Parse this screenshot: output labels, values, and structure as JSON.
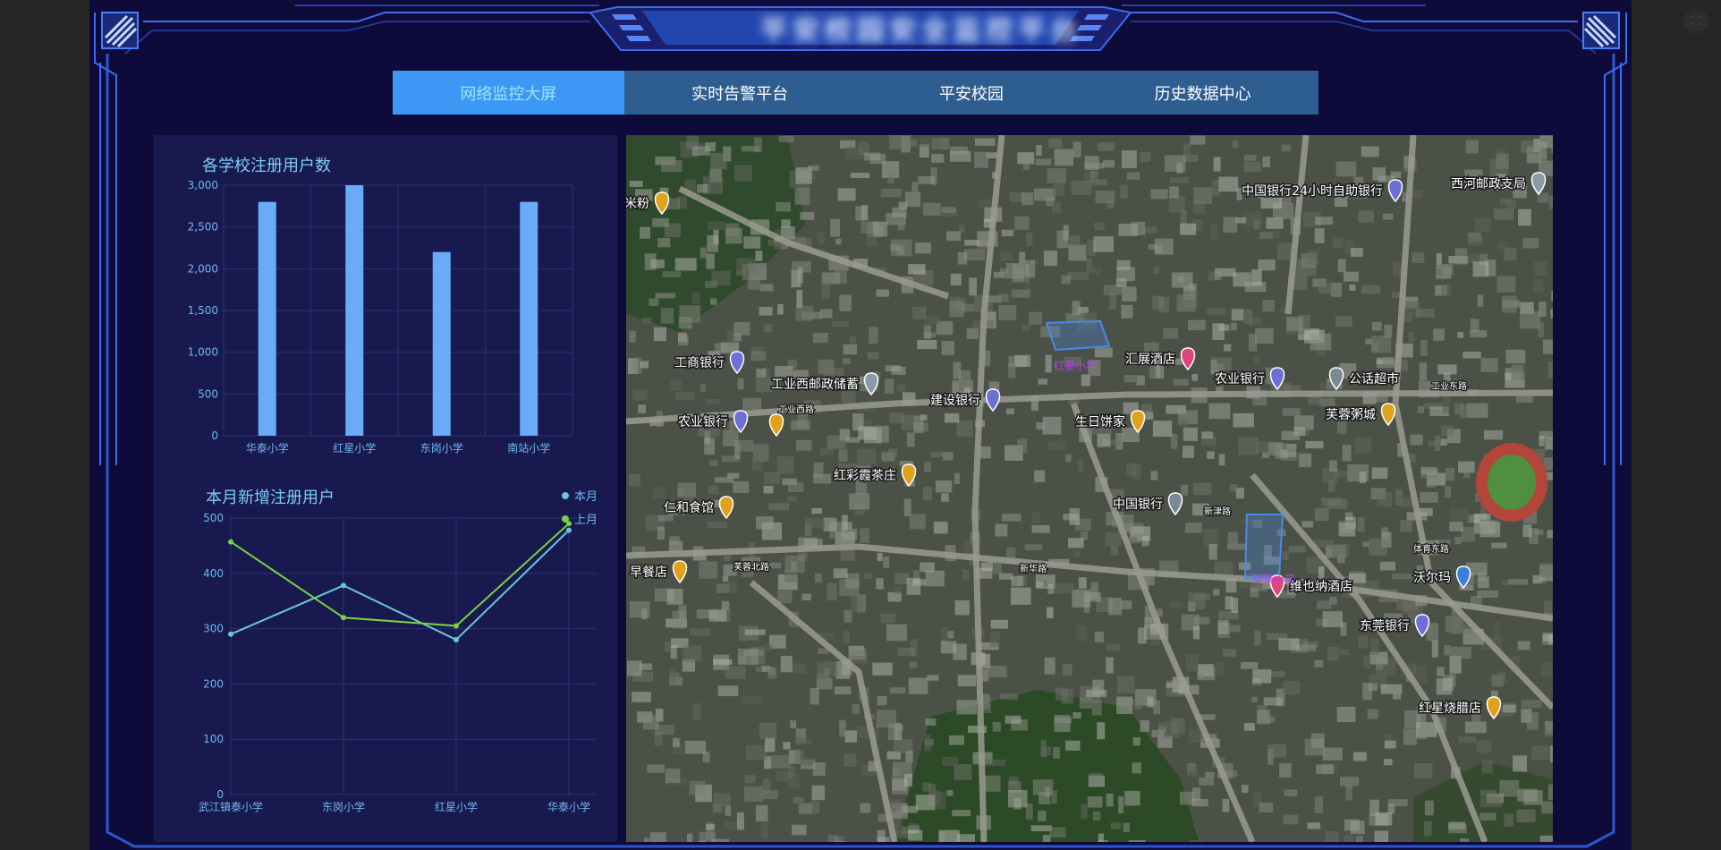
{
  "header": {
    "title": "平安校园安全监控平台"
  },
  "nav": {
    "tabs": [
      {
        "label": "网络监控大屏",
        "active": true
      },
      {
        "label": "实时告警平台",
        "active": false
      },
      {
        "label": "平安校园",
        "active": false
      },
      {
        "label": "历史数据中心",
        "active": false
      }
    ]
  },
  "colors": {
    "background": "#0e0b3a",
    "panel": "#181a4f",
    "accent": "#3d97f5",
    "bar": "#6aaaf8",
    "series_this_month": "#6fc4d8",
    "series_last_month": "#7ad142"
  },
  "chart_data": [
    {
      "type": "bar",
      "title": "各学校注册用户数",
      "categories": [
        "华泰小学",
        "红星小学",
        "东岗小学",
        "南站小学"
      ],
      "values": [
        2800,
        3000,
        2200,
        2800
      ],
      "ylim": [
        0,
        3000
      ],
      "yticks": [
        "0",
        "500",
        "1,000",
        "1,500",
        "2,000",
        "2,500",
        "3,000"
      ],
      "grid": true
    },
    {
      "type": "line",
      "title": "本月新增注册用户",
      "categories": [
        "武江镇泰小学",
        "东岗小学",
        "红星小学",
        "华泰小学"
      ],
      "ylim": [
        0,
        500
      ],
      "yticks": [
        "0",
        "100",
        "200",
        "300",
        "400",
        "500"
      ],
      "legend_position": "top-right",
      "series": [
        {
          "name": "本月",
          "values": [
            290,
            378,
            280,
            478
          ]
        },
        {
          "name": "上月",
          "values": [
            457,
            320,
            305,
            490
          ]
        }
      ],
      "grid": true
    }
  ],
  "map": {
    "poi_labels": [
      "林米粉",
      "中国银行24小时自助银行",
      "西河邮政支局",
      "工商银行",
      "工业西邮政储蓄",
      "汇展酒店",
      "农业银行",
      "公话超市",
      "建设银行",
      "生日饼家",
      "芙蓉粥城",
      "农业银行",
      "红彩霞茶庄",
      "中国银行",
      "仁和食馆",
      "早餐店",
      "维也纳酒店",
      "沃尔玛",
      "东莞银行",
      "红星烧腊店"
    ],
    "road_labels": [
      "工业西路",
      "芙蓉北路",
      "新华路",
      "新津路",
      "体育东路",
      "工业东路"
    ],
    "school_labels": [
      "红星小学",
      "华泰小学"
    ]
  }
}
